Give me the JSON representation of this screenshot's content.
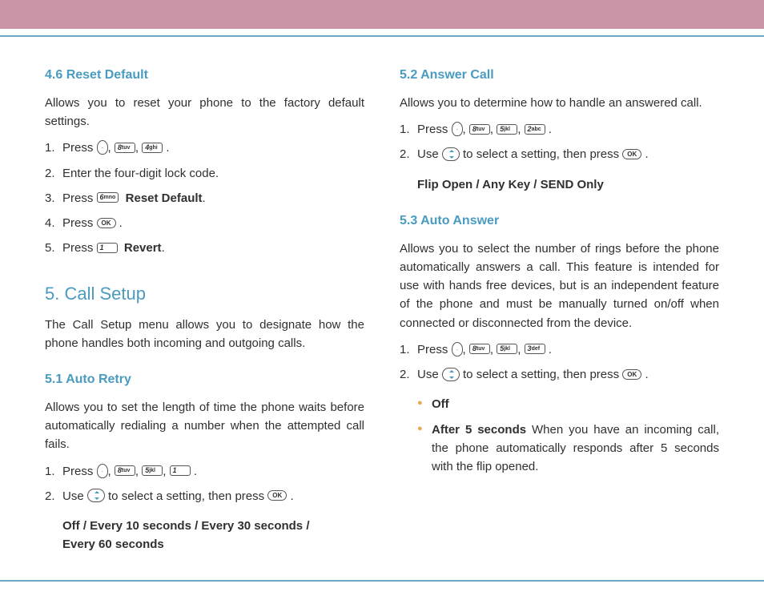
{
  "left": {
    "sec46": {
      "title": "4.6 Reset Default",
      "intro": "Allows you to reset your phone to the factory default settings.",
      "s1a": "Press  ",
      "k1": "8",
      "k1s": "tuv",
      "k2": "4",
      "k2s": "ghi",
      "s2": "Enter the four-digit lock code.",
      "s3a": "Press  ",
      "k3": "6",
      "k3s": "mno",
      "s3b": "Reset Default",
      "s4a": "Press  ",
      "ok": "OK",
      "s5a": "Press  ",
      "k5": "1",
      "k5s": "",
      "s5b": "Revert"
    },
    "sec5": {
      "title": "5. Call Setup",
      "intro": "The Call Setup menu allows you to designate how the phone handles both incoming and outgoing calls."
    },
    "sec51": {
      "title": "5.1 Auto Retry",
      "intro": "Allows you to set the length of time the phone waits before automatically redialing a number when the attempted call fails.",
      "s1a": "Press  ",
      "k1": "8",
      "k1s": "tuv",
      "k2": "5",
      "k2s": "jkl",
      "k3": "1",
      "k3s": "",
      "s2a": "Use  ",
      "s2b": "  to select a setting, then press  ",
      "ok": "OK",
      "opts1": "Off / Every 10 seconds / Every 30 seconds /",
      "opts2": "Every 60 seconds"
    }
  },
  "right": {
    "sec52": {
      "title": "5.2 Answer Call",
      "intro": "Allows you to determine how to handle an answered call.",
      "s1a": "Press  ",
      "k1": "8",
      "k1s": "tuv",
      "k2": "5",
      "k2s": "jkl",
      "k3": "2",
      "k3s": "abc",
      "s2a": "Use  ",
      "s2b": "  to select a setting, then press  ",
      "ok": "OK",
      "opts": "Flip Open / Any Key / SEND Only"
    },
    "sec53": {
      "title": "5.3 Auto Answer",
      "intro": "Allows you to select the number of rings before the phone automatically answers a call. This feature is intended for use with hands free devices, but is an independent feature of the phone and must be manually turned on/off when connected or disconnected from the device.",
      "s1a": "Press  ",
      "k1": "8",
      "k1s": "tuv",
      "k2": "5",
      "k2s": "jkl",
      "k3": "3",
      "k3s": "def",
      "s2a": "Use  ",
      "s2b": "  to select a setting, then press  ",
      "ok": "OK",
      "b1": "Off",
      "b2a": "After 5 seconds",
      "b2b": " When you have an incoming call, the phone automatically responds after 5 seconds with the flip opened."
    }
  },
  "nums": {
    "n1": "1.",
    "n2": "2.",
    "n3": "3.",
    "n4": "4.",
    "n5": "5."
  },
  "punct": {
    "c": ",  ",
    "p": " ."
  }
}
